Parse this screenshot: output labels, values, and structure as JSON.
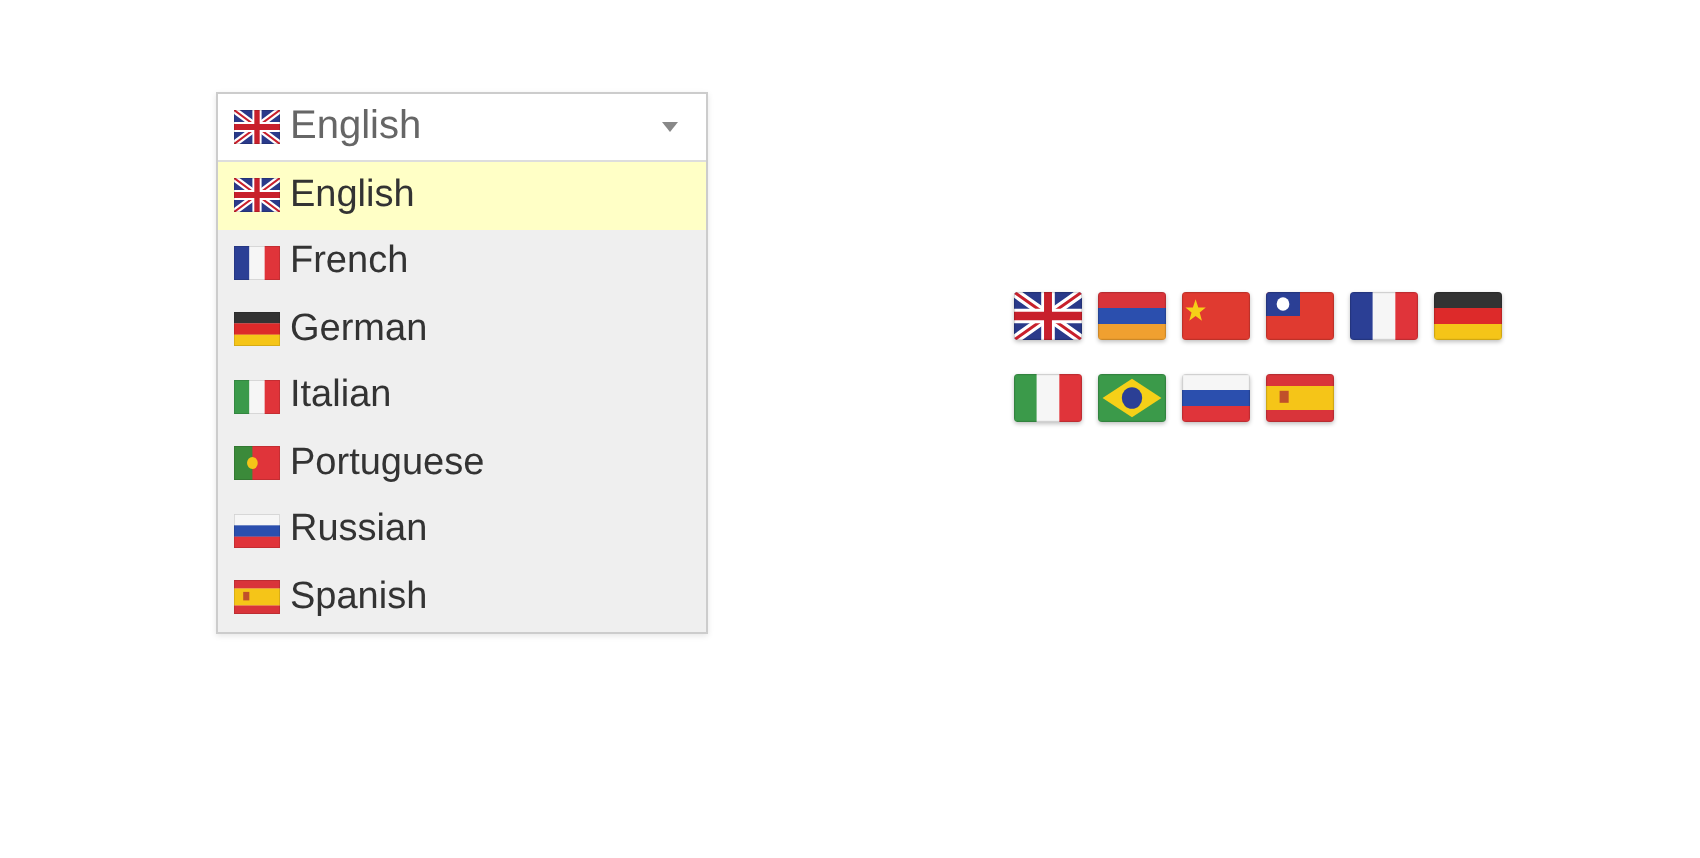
{
  "dropdown": {
    "value": {
      "label": "English",
      "kind": "uk"
    },
    "options": [
      {
        "label": "English",
        "kind": "uk",
        "selected": true
      },
      {
        "label": "French",
        "kind": "fr",
        "selected": false
      },
      {
        "label": "German",
        "kind": "de",
        "selected": false
      },
      {
        "label": "Italian",
        "kind": "it",
        "selected": false
      },
      {
        "label": "Portuguese",
        "kind": "pt",
        "selected": false
      },
      {
        "label": "Russian",
        "kind": "ru",
        "selected": false
      },
      {
        "label": "Spanish",
        "kind": "es",
        "selected": false
      }
    ]
  },
  "flags": [
    {
      "kind": "uk"
    },
    {
      "kind": "am"
    },
    {
      "kind": "cn"
    },
    {
      "kind": "tw"
    },
    {
      "kind": "fr"
    },
    {
      "kind": "de"
    },
    {
      "kind": "it"
    },
    {
      "kind": "br"
    },
    {
      "kind": "ru"
    },
    {
      "kind": "es"
    }
  ]
}
